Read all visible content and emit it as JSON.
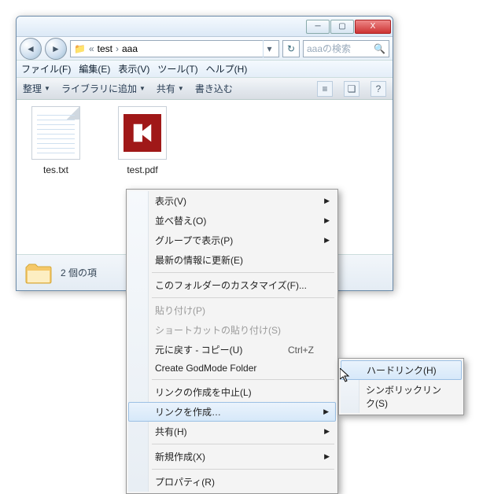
{
  "titlebar": {
    "min": "─",
    "max": "▢",
    "close": "X"
  },
  "nav": {
    "back": "◄",
    "fwd": "►",
    "path_prefix": "«",
    "path_seg1": "test",
    "sep": "›",
    "path_seg2": "aaa",
    "dropdown": "▾",
    "refresh": "↻"
  },
  "search": {
    "placeholder": "aaaの検索",
    "icon": "🔍"
  },
  "menubar": {
    "file": "ファイル(F)",
    "edit": "編集(E)",
    "view": "表示(V)",
    "tools": "ツール(T)",
    "help": "ヘルプ(H)"
  },
  "toolbar": {
    "organize": "整理",
    "addlib": "ライブラリに追加",
    "share": "共有",
    "burn": "書き込む",
    "icon1": "≡",
    "icon2": "❏",
    "icon3": "?"
  },
  "files": {
    "f1": "tes.txt",
    "f2": "test.pdf"
  },
  "status": {
    "text": "2 個の項"
  },
  "ctx": {
    "view": "表示(V)",
    "sort": "並べ替え(O)",
    "group": "グループで表示(P)",
    "refresh": "最新の情報に更新(E)",
    "customize": "このフォルダーのカスタマイズ(F)...",
    "paste": "貼り付け(P)",
    "paste_sc": "ショートカットの貼り付け(S)",
    "undo": "元に戻す - コピー(U)",
    "undo_sc": "Ctrl+Z",
    "godmode": "Create GodMode Folder",
    "cancel_link": "リンクの作成を中止(L)",
    "create_link": "リンクを作成…",
    "share": "共有(H)",
    "new": "新規作成(X)",
    "props": "プロパティ(R)",
    "arrow": "▶"
  },
  "sub": {
    "hardlink": "ハードリンク(H)",
    "symlink": "シンボリックリンク(S)"
  }
}
